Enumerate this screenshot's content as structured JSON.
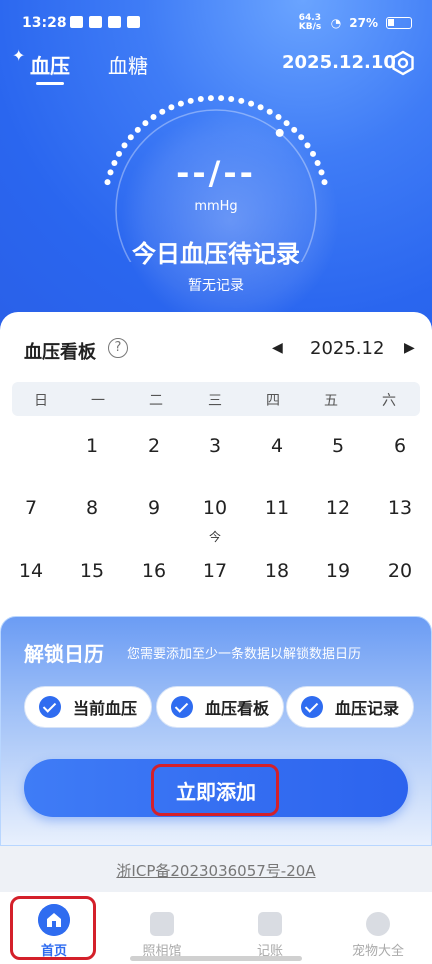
{
  "status": {
    "time": "13:28",
    "network_speed": "64.3 KB/s",
    "battery": "27%"
  },
  "header": {
    "tabs": [
      "血压",
      "血糖"
    ],
    "date": "2025.12.10"
  },
  "gauge": {
    "value": "--/--",
    "unit": "mmHg",
    "title": "今日血压待记录",
    "subtitle": "暂无记录"
  },
  "board": {
    "title": "血压看板",
    "help_icon": "?",
    "month": "2025.12",
    "prev": "◀",
    "next": "▶",
    "weekdays": [
      "日",
      "一",
      "二",
      "三",
      "四",
      "五",
      "六"
    ],
    "rows": [
      [
        "",
        "1",
        "2",
        "3",
        "4",
        "5",
        "6"
      ],
      [
        "7",
        "8",
        "9",
        "10",
        "11",
        "12",
        "13"
      ],
      [
        "14",
        "15",
        "16",
        "17",
        "18",
        "19",
        "20"
      ]
    ],
    "today_mark": "今"
  },
  "unlock": {
    "title": "解锁日历",
    "desc": "您需要添加至少一条数据以解锁数据日历",
    "chips": [
      "当前血压",
      "血压看板",
      "血压记录"
    ],
    "button": "立即添加"
  },
  "footer": {
    "icp": "浙ICP备2023036057号-20A"
  },
  "bottom_nav": [
    {
      "label": "首页",
      "icon": "home-icon",
      "active": true
    },
    {
      "label": "照相馆",
      "icon": "photo-icon",
      "active": false
    },
    {
      "label": "记账",
      "icon": "wallet-icon",
      "active": false
    },
    {
      "label": "宠物大全",
      "icon": "paw-icon",
      "active": false
    }
  ],
  "colors": {
    "primary": "#2f6cf0",
    "highlight": "#d4202a"
  }
}
